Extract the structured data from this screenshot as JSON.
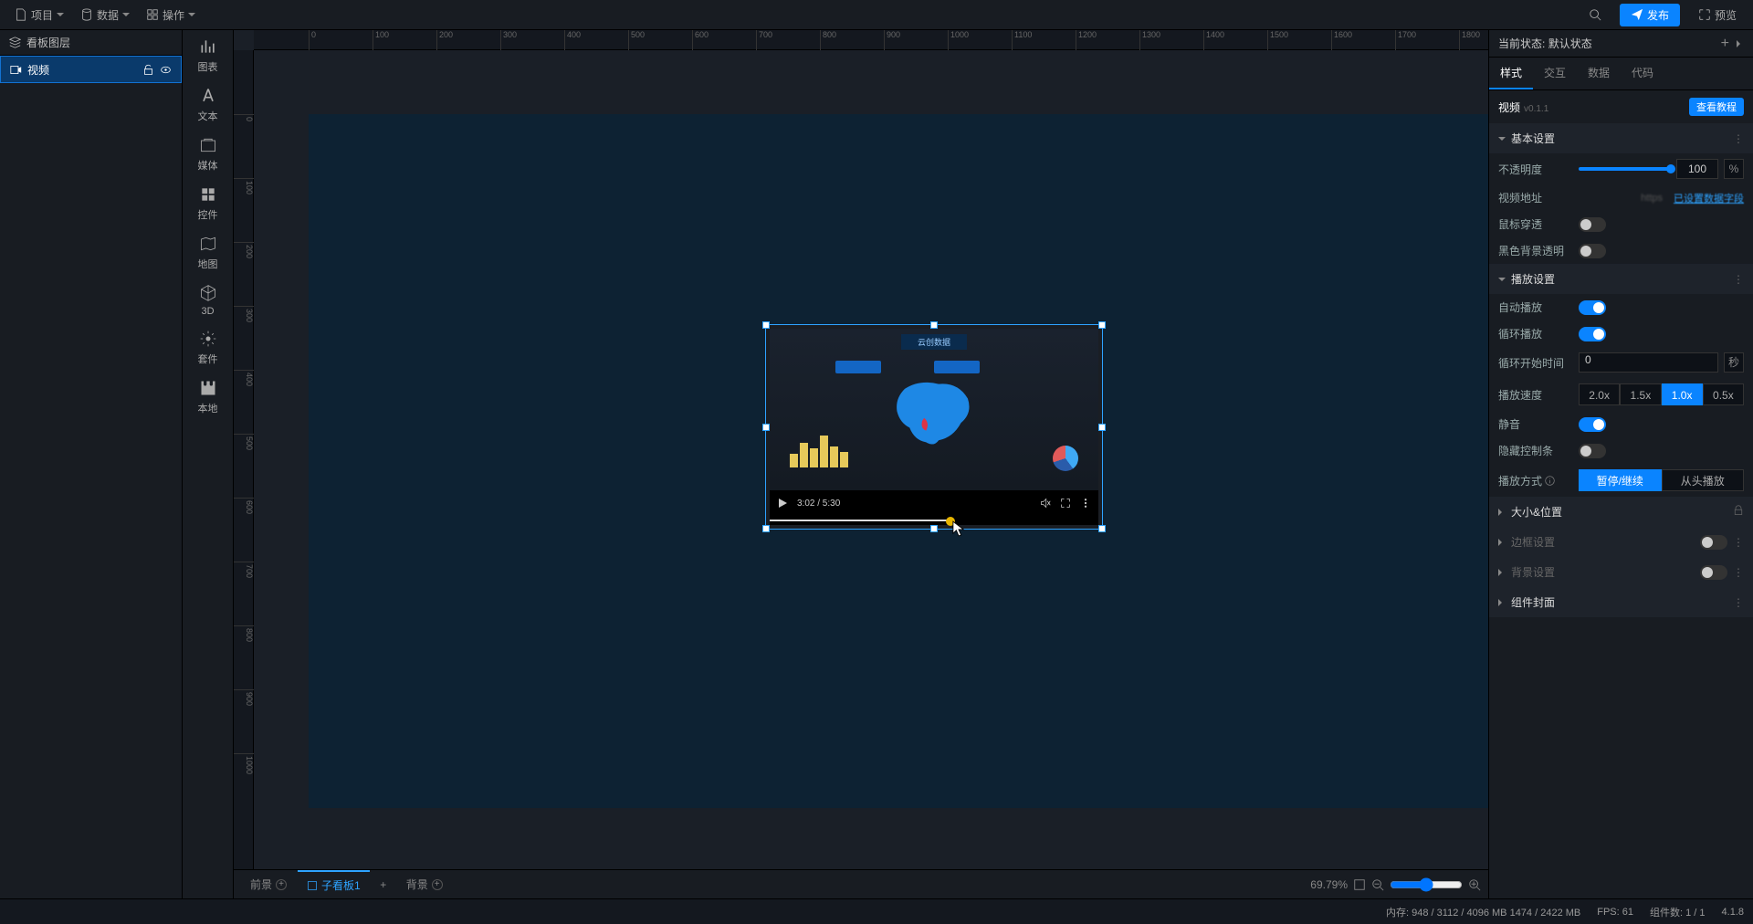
{
  "topbar": {
    "menu": [
      "项目",
      "数据",
      "操作"
    ],
    "publish": "发布",
    "preview": "预览"
  },
  "layers": {
    "title": "看板图层",
    "items": [
      "视频"
    ]
  },
  "toolbox": [
    "图表",
    "文本",
    "媒体",
    "控件",
    "地图",
    "3D",
    "套件",
    "本地"
  ],
  "rulerH": [
    "0",
    "100",
    "200",
    "300",
    "400",
    "500",
    "600",
    "700",
    "800",
    "900",
    "1000",
    "1100",
    "1200",
    "1300",
    "1400",
    "1500",
    "1600",
    "1700",
    "1800"
  ],
  "rulerV": [
    "0",
    "100",
    "200",
    "300",
    "400",
    "500",
    "600",
    "700",
    "800",
    "900",
    "1000"
  ],
  "video": {
    "title": "云创数据",
    "time": "3:02 / 5:30"
  },
  "props": {
    "stateLabel": "当前状态:",
    "stateValue": "默认状态",
    "tabs": [
      "样式",
      "交互",
      "数据",
      "代码"
    ],
    "compName": "视频",
    "compVer": "v0.1.1",
    "tutorial": "查看教程",
    "basicHdr": "基本设置",
    "opacityLbl": "不透明度",
    "opacityVal": "100",
    "opacityUnit": "%",
    "urlLbl": "视频地址",
    "urlPrefix": "https",
    "urlLink": "已设置数据字段",
    "mouseThroughLbl": "鼠标穿透",
    "blackBgLbl": "黑色背景透明",
    "playHdr": "播放设置",
    "autoplayLbl": "自动播放",
    "loopLbl": "循环播放",
    "loopStartLbl": "循环开始时间",
    "loopStartVal": "0",
    "loopStartUnit": "秒",
    "speedLbl": "播放速度",
    "speeds": [
      "2.0x",
      "1.5x",
      "1.0x",
      "0.5x"
    ],
    "speedActive": "1.0x",
    "muteLbl": "静音",
    "hideCtrlLbl": "隐藏控制条",
    "playModeLbl": "播放方式",
    "playModes": [
      "暂停/继续",
      "从头播放"
    ],
    "playModeActive": "暂停/继续",
    "sizeHdr": "大小&位置",
    "borderHdr": "边框设置",
    "bgHdr": "背景设置",
    "coverHdr": "组件封面"
  },
  "foot": {
    "front": "前景",
    "active": "子看板1",
    "back": "背景",
    "zoom": "69.79%"
  },
  "status": {
    "mem": "内存:  948 / 3112 / 4096 MB  1474 / 2422 MB",
    "fps": "FPS:  61",
    "comp": "组件数: 1 / 1",
    "ver": "4.1.8"
  }
}
